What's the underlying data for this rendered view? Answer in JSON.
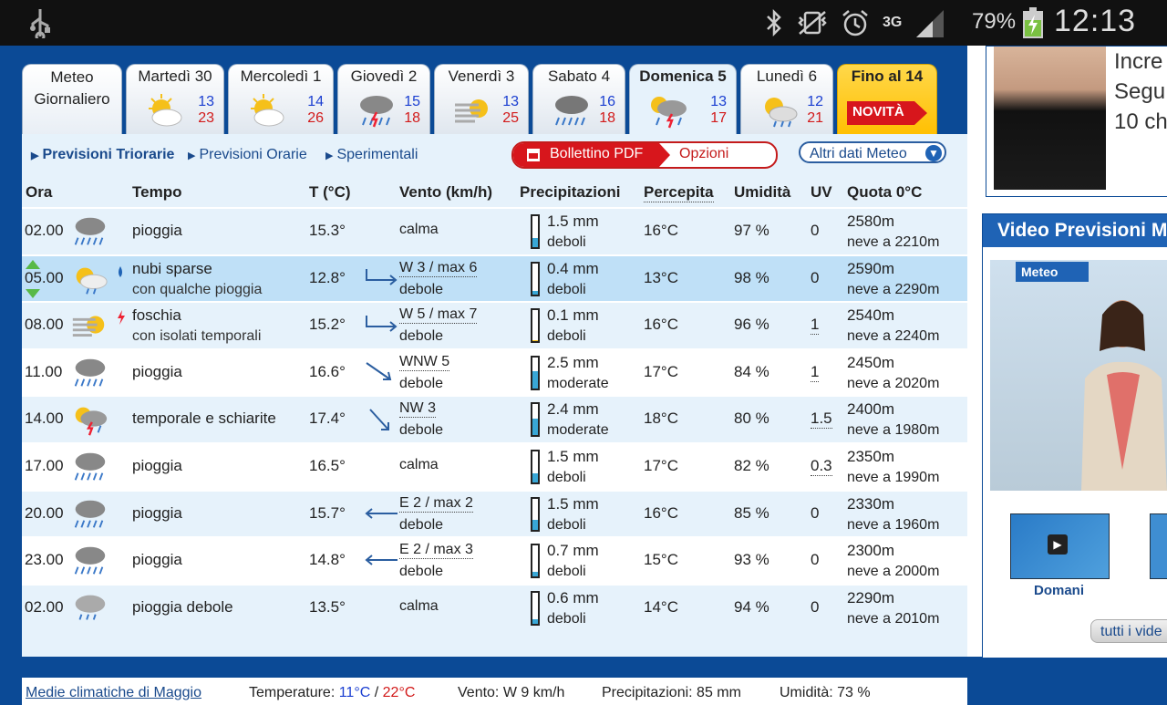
{
  "status_bar": {
    "battery": "79%",
    "time": "12:13",
    "network": "3G"
  },
  "tabs": [
    {
      "name": "Meteo\nGiornaliero",
      "line1": "Meteo",
      "line2": "Giornaliero"
    },
    {
      "name": "Martedì 30",
      "min": "13",
      "max": "23",
      "icon": "sun-cloud-icon"
    },
    {
      "name": "Mercoledì 1",
      "min": "14",
      "max": "26",
      "icon": "sun-cloud-icon"
    },
    {
      "name": "Giovedì 2",
      "min": "15",
      "max": "18",
      "icon": "storm-rain-icon"
    },
    {
      "name": "Venerdì 3",
      "min": "13",
      "max": "25",
      "icon": "fog-icon"
    },
    {
      "name": "Sabato 4",
      "min": "16",
      "max": "18",
      "icon": "rain-icon"
    },
    {
      "name": "Domenica 5",
      "min": "13",
      "max": "17",
      "icon": "storm-sun-icon"
    },
    {
      "name": "Lunedì 6",
      "min": "12",
      "max": "21",
      "icon": "sun-rain-icon"
    },
    {
      "name": "Fino al 14",
      "badge": "NOVITÀ"
    }
  ],
  "subnav": {
    "triorarie": "Previsioni Triorarie",
    "orarie": "Previsioni Orarie",
    "sperimentali": "Sperimentali",
    "pdf": "Bollettino PDF",
    "opzioni": "Opzioni",
    "altri": "Altri dati Meteo"
  },
  "headers": {
    "ora": "Ora",
    "tempo": "Tempo",
    "temp": "T (°C)",
    "vento": "Vento (km/h)",
    "prec": "Precipitazioni",
    "perc": "Percepita",
    "umid": "Umidità",
    "uv": "UV",
    "quota": "Quota 0°C"
  },
  "rows": [
    {
      "ora": "02.00",
      "tempo": "pioggia",
      "tempo2": "",
      "temp": "15.3°",
      "vento": "calma",
      "vento2": "",
      "prec": "1.5 mm",
      "prec2": "deboli",
      "fill": 0.3,
      "perc": "16°C",
      "umid": "97 %",
      "uv": "0",
      "quota": "2580m",
      "quota2": "neve a 2210m"
    },
    {
      "ora": "05.00",
      "tempo": "nubi sparse",
      "tempo2": "con qualche pioggia",
      "temp": "12.8°",
      "vento": "W 3 / max 6",
      "vento2": "debole",
      "prec": "0.4 mm",
      "prec2": "deboli",
      "fill": 0.1,
      "perc": "13°C",
      "umid": "98 %",
      "uv": "0",
      "quota": "2590m",
      "quota2": "neve a 2290m"
    },
    {
      "ora": "08.00",
      "tempo": "foschia",
      "tempo2": "con isolati temporali",
      "temp": "15.2°",
      "vento": "W 5 / max 7",
      "vento2": "debole",
      "prec": "0.1 mm",
      "prec2": "deboli",
      "fill": 0.05,
      "perc": "16°C",
      "umid": "96 %",
      "uv": "1",
      "quota": "2540m",
      "quota2": "neve a 2240m"
    },
    {
      "ora": "11.00",
      "tempo": "pioggia",
      "tempo2": "",
      "temp": "16.6°",
      "vento": "WNW 5",
      "vento2": "debole",
      "prec": "2.5 mm",
      "prec2": "moderate",
      "fill": 0.55,
      "perc": "17°C",
      "umid": "84 %",
      "uv": "1",
      "quota": "2450m",
      "quota2": "neve a 2020m"
    },
    {
      "ora": "14.00",
      "tempo": "temporale e schiarite",
      "tempo2": "",
      "temp": "17.4°",
      "vento": "NW 3",
      "vento2": "debole",
      "prec": "2.4 mm",
      "prec2": "moderate",
      "fill": 0.55,
      "perc": "18°C",
      "umid": "80 %",
      "uv": "1.5",
      "quota": "2400m",
      "quota2": "neve a 1980m"
    },
    {
      "ora": "17.00",
      "tempo": "pioggia",
      "tempo2": "",
      "temp": "16.5°",
      "vento": "calma",
      "vento2": "",
      "prec": "1.5 mm",
      "prec2": "deboli",
      "fill": 0.3,
      "perc": "17°C",
      "umid": "82 %",
      "uv": "0.3",
      "quota": "2350m",
      "quota2": "neve a 1990m"
    },
    {
      "ora": "20.00",
      "tempo": "pioggia",
      "tempo2": "",
      "temp": "15.7°",
      "vento": "E 2 / max 2",
      "vento2": "debole",
      "prec": "1.5 mm",
      "prec2": "deboli",
      "fill": 0.3,
      "perc": "16°C",
      "umid": "85 %",
      "uv": "0",
      "quota": "2330m",
      "quota2": "neve a 1960m"
    },
    {
      "ora": "23.00",
      "tempo": "pioggia",
      "tempo2": "",
      "temp": "14.8°",
      "vento": "E 2 / max 3",
      "vento2": "debole",
      "prec": "0.7 mm",
      "prec2": "deboli",
      "fill": 0.15,
      "perc": "15°C",
      "umid": "93 %",
      "uv": "0",
      "quota": "2300m",
      "quota2": "neve a 2000m"
    },
    {
      "ora": "02.00",
      "tempo": "pioggia debole",
      "tempo2": "",
      "temp": "13.5°",
      "vento": "calma",
      "vento2": "",
      "prec": "0.6 mm",
      "prec2": "deboli",
      "fill": 0.15,
      "perc": "14°C",
      "umid": "94 %",
      "uv": "0",
      "quota": "2290m",
      "quota2": "neve a 2010m"
    }
  ],
  "footer": {
    "medie": "Medie climatiche di Maggio",
    "temp_label": "Temperature:",
    "tmin": "11°C",
    "sep": "/",
    "tmax": "22°C",
    "vento": "Vento: W 9 km/h",
    "prec": "Precipitazioni: 85 mm",
    "umid": "Umidità: 73 %"
  },
  "sidebar": {
    "ad_text": [
      "Incre",
      "Segu",
      "10 ch"
    ],
    "video_title": "Video Previsioni M",
    "video_logo": "Meteo",
    "domani": "Domani",
    "tutti": "tutti i vide"
  },
  "colors": {
    "brand_blue": "#0b4a96",
    "min_temp": "#1b3fd1",
    "max_temp": "#d21a1a",
    "accent_red": "#d7161c"
  }
}
